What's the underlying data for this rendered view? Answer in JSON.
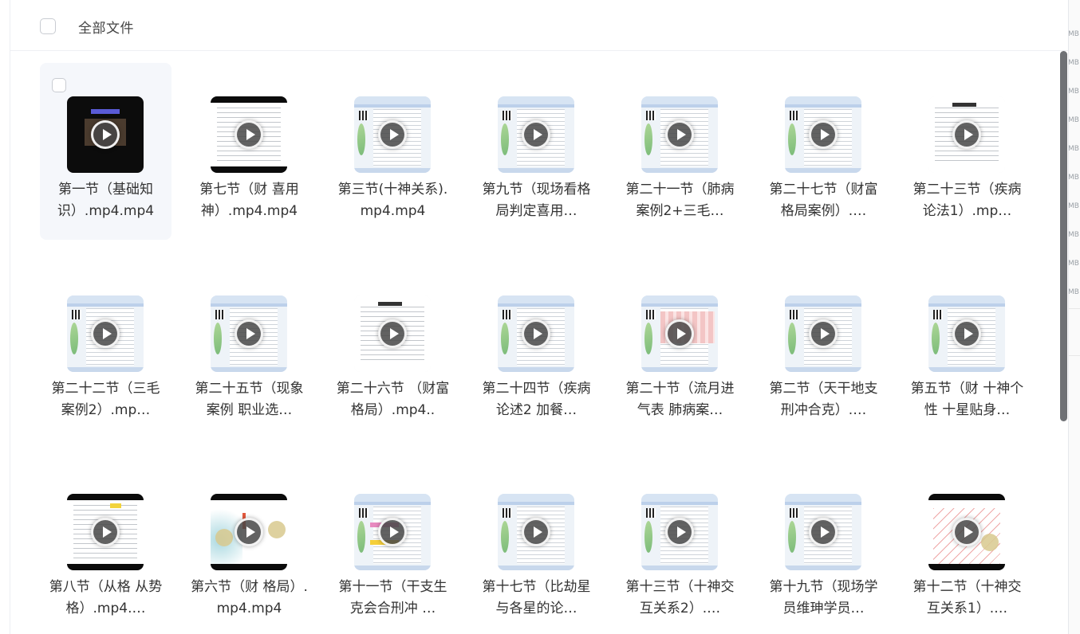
{
  "header": {
    "title": "全部文件"
  },
  "colors": {
    "selected_bg": "#f5f7fb",
    "scrollbar": "#6f7175"
  },
  "files": [
    {
      "name": "第一节（基础知识）.mp4.mp4",
      "thumb": "black-video",
      "selected": true
    },
    {
      "name": "第七节（财 喜用神）.mp4.mp4",
      "thumb": "document-letterbox"
    },
    {
      "name": "第三节(十神关系).mp4.mp4",
      "thumb": "app-screen"
    },
    {
      "name": "第九节（现场看格局判定喜用…",
      "thumb": "app-screen"
    },
    {
      "name": "第二十一节（肺病案例2+三毛…",
      "thumb": "app-screen"
    },
    {
      "name": "第二十七节（财富格局案例）.…",
      "thumb": "app-screen"
    },
    {
      "name": "第二十三节（疾病论法1）.mp…",
      "thumb": "document"
    },
    {
      "name": "第二十二节（三毛案例2）.mp…",
      "thumb": "app-screen"
    },
    {
      "name": "第二十五节（现象案例 职业选…",
      "thumb": "app-screen"
    },
    {
      "name": "第二十六节 （财富格局）.mp4..",
      "thumb": "document"
    },
    {
      "name": "第二十四节（疾病论述2 加餐…",
      "thumb": "app-screen"
    },
    {
      "name": "第二十节（流月进气表 肺病案…",
      "thumb": "pink-table"
    },
    {
      "name": "第二节（天干地支刑冲合克）.…",
      "thumb": "app-screen"
    },
    {
      "name": "第五节（财 十神个性 十星贴身…",
      "thumb": "app-screen"
    },
    {
      "name": "第八节（从格 从势格）.mp4.…",
      "thumb": "document-letterbox-highlight"
    },
    {
      "name": "第六节（财 格局）.mp4.mp4",
      "thumb": "artwork-letterbox"
    },
    {
      "name": "第十一节（干支生克会合刑冲 …",
      "thumb": "app-highlight"
    },
    {
      "name": "第十七节（比劫星与各星的论…",
      "thumb": "app-screen"
    },
    {
      "name": "第十三节（十神交互关系2）.…",
      "thumb": "app-screen"
    },
    {
      "name": "第十九节（现场学员维珅学员…",
      "thumb": "app-screen"
    },
    {
      "name": "第十二节（十神交互关系1）.…",
      "thumb": "handwriting-letterbox"
    }
  ],
  "background_sizes": [
    "MB",
    "MB",
    "MB",
    "MB",
    "MB",
    "MB",
    "MB",
    "MB",
    "MB",
    "MB"
  ]
}
